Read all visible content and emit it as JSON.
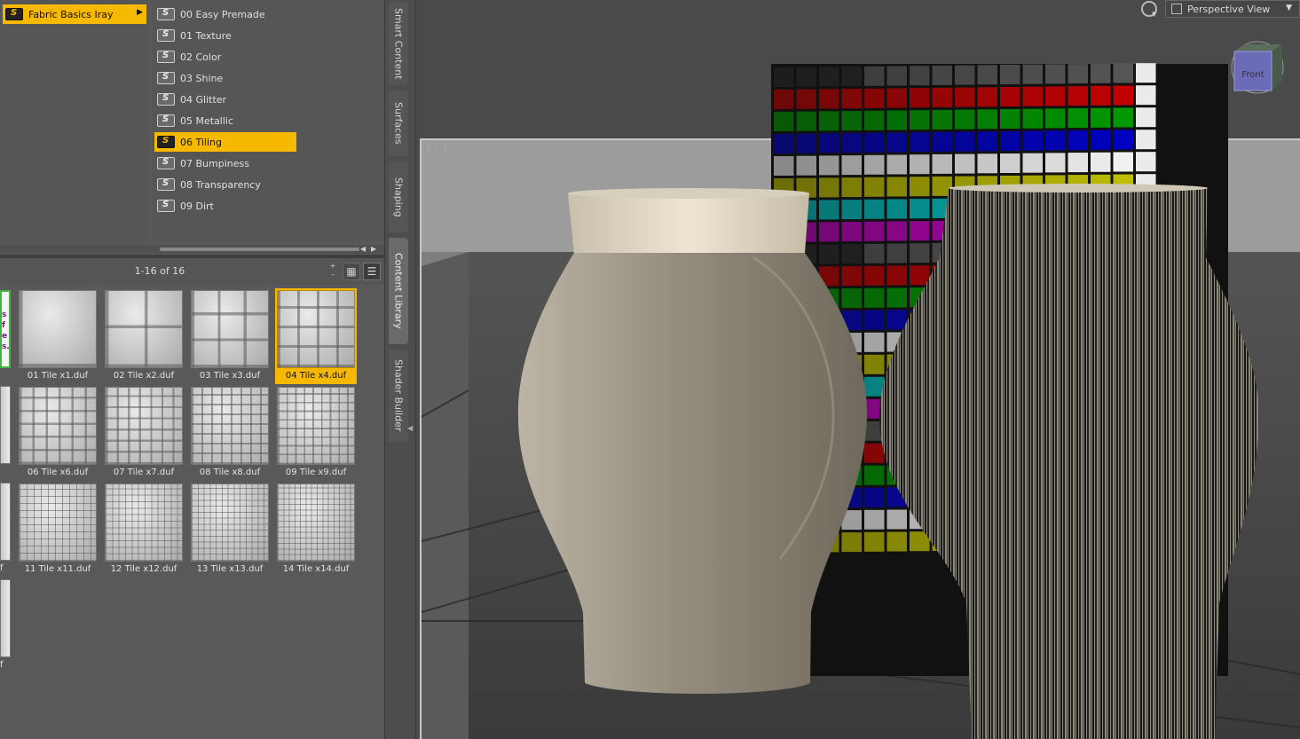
{
  "library": {
    "root_folder": {
      "label": "Fabric Basics Iray",
      "selected": true
    },
    "subfolders": [
      {
        "label": "00 Easy Premade",
        "selected": false
      },
      {
        "label": "01 Texture",
        "selected": false
      },
      {
        "label": "02 Color",
        "selected": false
      },
      {
        "label": "03 Shine",
        "selected": false
      },
      {
        "label": "04 Glitter",
        "selected": false
      },
      {
        "label": "05 Metallic",
        "selected": false
      },
      {
        "label": "06 Tiling",
        "selected": true
      },
      {
        "label": "07 Bumpiness",
        "selected": false
      },
      {
        "label": "08 Transparency",
        "selected": false
      },
      {
        "label": "09 Dirt",
        "selected": false
      }
    ],
    "page_count": "1-16 of 16",
    "thumbnails": [
      {
        "label": "01 Tile x1.duf",
        "tiles": 1,
        "selected": false
      },
      {
        "label": "02 Tile x2.duf",
        "tiles": 2,
        "selected": false
      },
      {
        "label": "03 Tile x3.duf",
        "tiles": 3,
        "selected": false
      },
      {
        "label": "04 Tile x4.duf",
        "tiles": 4,
        "selected": true
      },
      {
        "label": "06 Tile x6.duf",
        "tiles": 6,
        "selected": false
      },
      {
        "label": "07 Tile x7.duf",
        "tiles": 7,
        "selected": false
      },
      {
        "label": "08 Tile x8.duf",
        "tiles": 8,
        "selected": false
      },
      {
        "label": "09 Tile x9.duf",
        "tiles": 9,
        "selected": false
      },
      {
        "label": "11 Tile x11.duf",
        "tiles": 11,
        "selected": false
      },
      {
        "label": "12 Tile x12.duf",
        "tiles": 12,
        "selected": false
      },
      {
        "label": "13 Tile x13.duf",
        "tiles": 13,
        "selected": false
      },
      {
        "label": "14 Tile x14.duf",
        "tiles": 14,
        "selected": false
      }
    ],
    "partial_labels": [
      "f",
      "f",
      "f"
    ],
    "partial_readme_text": [
      "s",
      "f",
      "e",
      "s."
    ]
  },
  "side_tabs": [
    {
      "label": "Smart Content",
      "active": false
    },
    {
      "label": "Surfaces",
      "active": false
    },
    {
      "label": "Shaping",
      "active": false
    },
    {
      "label": "Content Library",
      "active": true
    },
    {
      "label": "Shader Builder",
      "active": false
    }
  ],
  "viewport": {
    "view_name": "Perspective View",
    "aspect_ratio": "3 : 2",
    "nav_cube_face": "Front"
  },
  "colors": {
    "selection": "#f7b800",
    "panel_bg": "#595959",
    "viewport_bg": "#4b4b4b"
  },
  "icons": {
    "folder": "smart-content-folder-icon",
    "expand": "expand-arrow-icon",
    "grid_view": "grid-view-icon",
    "list_view": "list-view-icon",
    "view_options": "view-options-icon",
    "nav_cube": "nav-cube-icon"
  }
}
